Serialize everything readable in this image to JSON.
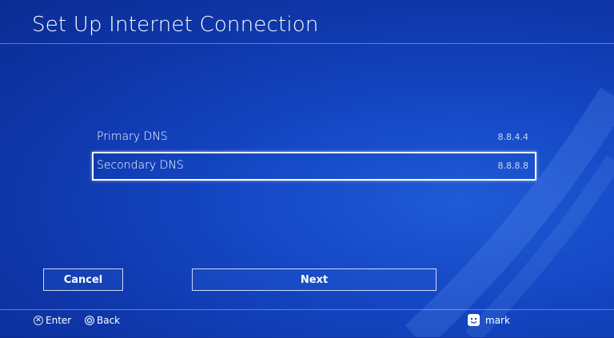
{
  "header": {
    "title": "Set Up Internet Connection"
  },
  "dns": {
    "rows": [
      {
        "label": "Primary DNS",
        "value": "8.8.4.4",
        "selected": false
      },
      {
        "label": "Secondary DNS",
        "value": "8.8.8.8",
        "selected": true
      }
    ]
  },
  "buttons": {
    "cancel_label": "Cancel",
    "next_label": "Next"
  },
  "footer": {
    "enter_label": "Enter",
    "back_label": "Back",
    "enter_icon": "cross-button-icon",
    "back_icon": "circle-button-icon",
    "user_name": "mark"
  },
  "colors": {
    "background": "#1447c4",
    "background_dark": "#0b2c94",
    "text": "#ffffff"
  }
}
